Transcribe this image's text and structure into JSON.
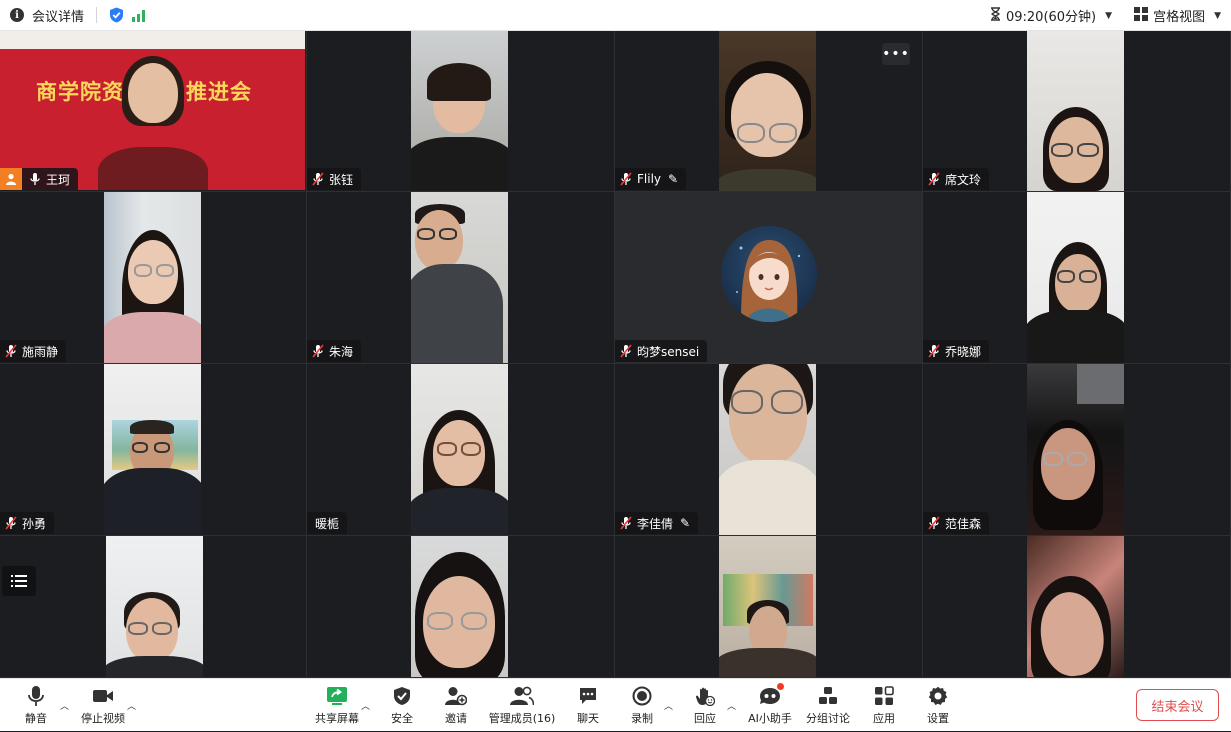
{
  "topbar": {
    "meeting_info_label": "会议详情",
    "timer": "09:20(60分钟)",
    "view_label": "宫格视图"
  },
  "banner_text": "商学院资",
  "banner_text_right": "推进会",
  "participants": [
    {
      "name": "王珂",
      "host": true
    },
    {
      "name": "张钰"
    },
    {
      "name": "Flily",
      "pencil": true
    },
    {
      "name": "席文玲"
    },
    {
      "name": "施雨静"
    },
    {
      "name": "朱海"
    },
    {
      "name": "昀梦sensei"
    },
    {
      "name": "乔晓娜"
    },
    {
      "name": "孙勇"
    },
    {
      "name": "暖栀"
    },
    {
      "name": "李佳倩",
      "pencil": true
    },
    {
      "name": "范佳森"
    }
  ],
  "toolbar": {
    "mute": "静音",
    "stop_video": "停止视频",
    "share_screen": "共享屏幕",
    "security": "安全",
    "invite": "邀请",
    "manage_members": "管理成员(16)",
    "chat": "聊天",
    "record": "录制",
    "react": "回应",
    "ai_assistant": "AI小助手",
    "breakout": "分组讨论",
    "apps": "应用",
    "settings": "设置",
    "end_meeting": "结束会议"
  }
}
